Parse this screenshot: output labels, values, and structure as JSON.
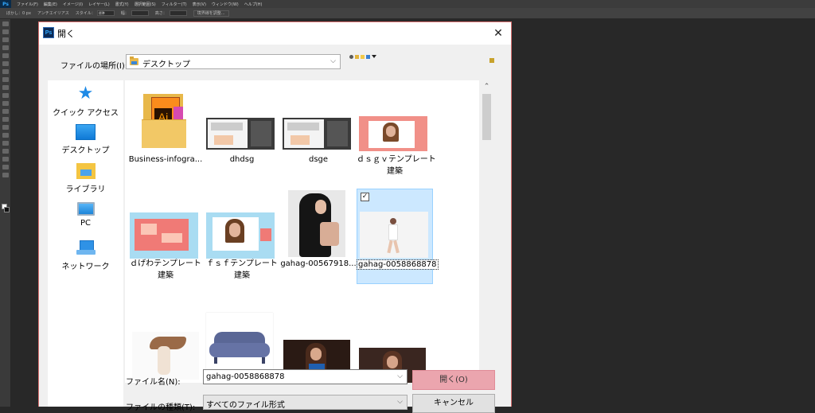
{
  "photoshop": {
    "logo": "Ps",
    "menu": [
      "ファイル(F)",
      "編集(E)",
      "イメージ(I)",
      "レイヤー(L)",
      "書式(Y)",
      "選択範囲(S)",
      "フィルター(T)",
      "表示(V)",
      "ウィンドウ(W)",
      "ヘルプ(H)"
    ],
    "options": [
      "ぼかし：0 px",
      "アンチエイリアス",
      "スタイル：",
      "標準",
      "幅：",
      "高さ：",
      "境界線を調整..."
    ]
  },
  "dialog": {
    "title": "開く",
    "close_glyph": "✕",
    "lookin_label": "ファイルの場所(I):",
    "lookin_value": "デスクトップ",
    "places": [
      {
        "label": "クイック アクセス",
        "icon": "star-icon"
      },
      {
        "label": "デスクトップ",
        "icon": "desktop-icon"
      },
      {
        "label": "ライブラリ",
        "icon": "library-icon"
      },
      {
        "label": "PC",
        "icon": "pc-icon"
      },
      {
        "label": "ネットワーク",
        "icon": "network-icon"
      }
    ],
    "files": [
      {
        "name": "Business-infogra...",
        "kind": "ai-folder"
      },
      {
        "name": "dhdsg",
        "kind": "screenshot"
      },
      {
        "name": "dsge",
        "kind": "screenshot"
      },
      {
        "name": "ｄｓｇｖテンプレート",
        "name2": "建築",
        "kind": "template-photo"
      },
      {
        "name": "ｄげわテンプレート",
        "name2": "建築",
        "kind": "template-pink"
      },
      {
        "name": "ｆｓｆテンプレート",
        "name2": "建築",
        "kind": "template-blue"
      },
      {
        "name": "gahag-00567918...",
        "kind": "portrait-hair"
      },
      {
        "name": "gahag-0058868878",
        "kind": "dancer",
        "selected": true
      },
      {
        "name": "",
        "kind": "hair-flip"
      },
      {
        "name": "",
        "kind": "sofa"
      },
      {
        "name": "",
        "kind": "woman-dark"
      },
      {
        "name": "",
        "kind": "woman-dark2"
      }
    ],
    "filename_label": "ファイル名(N):",
    "filename_value": "gahag-0058868878",
    "filetype_label": "ファイルの種類(T):",
    "filetype_value": "すべてのファイル形式",
    "open_label": "開く(O)",
    "cancel_label": "キャンセル",
    "check_glyph": "✓",
    "arrow_down": "⌵",
    "arrow_up": "⌃"
  }
}
